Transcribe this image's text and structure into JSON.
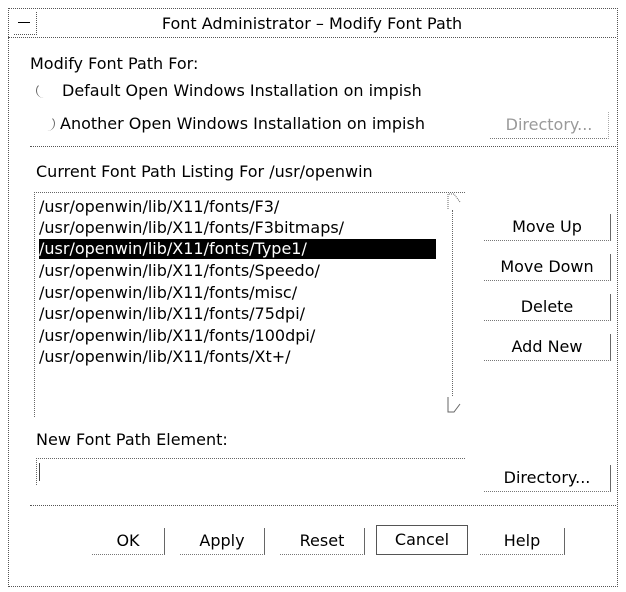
{
  "window": {
    "title": "Font Administrator – Modify Font Path"
  },
  "modify_section": {
    "heading": "Modify Font Path For:",
    "options": [
      {
        "label": "Default Open Windows Installation on impish",
        "selected": false
      },
      {
        "label": "Another Open Windows Installation on impish",
        "selected": false
      }
    ],
    "directory_button": "Directory..."
  },
  "listing": {
    "heading": "Current Font Path Listing For /usr/openwin",
    "items": [
      "/usr/openwin/lib/X11/fonts/F3/",
      "/usr/openwin/lib/X11/fonts/F3bitmaps/",
      "/usr/openwin/lib/X11/fonts/Type1/",
      "/usr/openwin/lib/X11/fonts/Speedo/",
      "/usr/openwin/lib/X11/fonts/misc/",
      "/usr/openwin/lib/X11/fonts/75dpi/",
      "/usr/openwin/lib/X11/fonts/100dpi/",
      "/usr/openwin/lib/X11/fonts/Xt+/"
    ],
    "selected_index": 2,
    "buttons": {
      "move_up": "Move Up",
      "move_down": "Move Down",
      "delete": "Delete",
      "add_new": "Add New"
    }
  },
  "new_element": {
    "heading": "New Font Path Element:",
    "value": "",
    "directory_button": "Directory..."
  },
  "footer": {
    "ok": "OK",
    "apply": "Apply",
    "reset": "Reset",
    "cancel": "Cancel",
    "help": "Help"
  },
  "icons": {
    "window_menu": "window-menu-icon",
    "scroll_up": "scroll-up-arrow-icon",
    "scroll_down": "scroll-down-arrow-icon"
  }
}
